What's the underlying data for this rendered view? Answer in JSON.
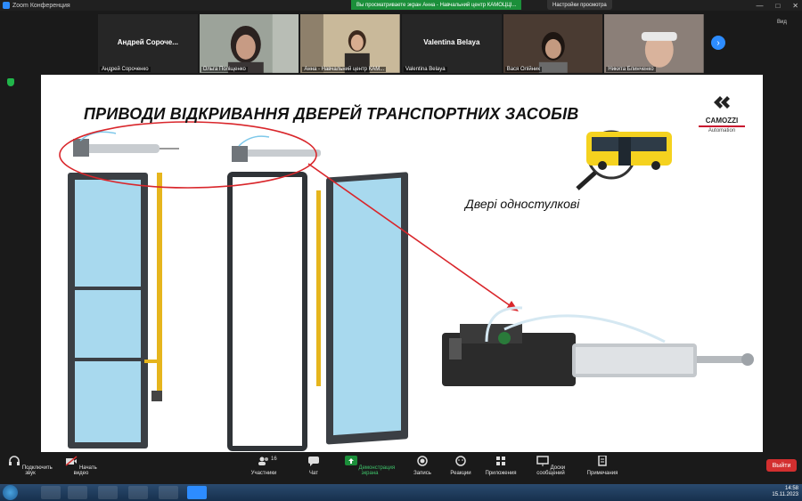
{
  "window": {
    "title": "Zoom Конференция",
    "share_banner": "Вы просматриваете экран Анна - Навчальний центр КАМОЦЦІ...",
    "view_options": "Настройки просмотра",
    "view_label": "Вид"
  },
  "participants": [
    {
      "big_name": "Андрей  Сороче...",
      "tag": "Андрей Сороченко",
      "video": false
    },
    {
      "big_name": "",
      "tag": "Ольга Поліщенко",
      "video": true,
      "bg": "#9ca39a",
      "face": "#c79b84",
      "hair": "#2b2220"
    },
    {
      "big_name": "",
      "tag": "Анна - Навчальний центр КАМ...",
      "video": true,
      "bg": "#c9b99a",
      "face": "#d8ad8f",
      "hair": "#3d2a1e"
    },
    {
      "big_name": "Valentina Belaya",
      "tag": "Valentina Belaya",
      "video": false
    },
    {
      "big_name": "",
      "tag": "Вася Олійник",
      "video": true,
      "bg": "#4a3b32",
      "face": "#c49a80",
      "hair": "#1e1612"
    },
    {
      "big_name": "",
      "tag": "Никита Блинченко",
      "video": true,
      "bg": "#8b7f78",
      "face": "#d9b39c",
      "hair": "#e8e8e8"
    }
  ],
  "slide": {
    "title": "ПРИВОДИ ВІДКРИВАННЯ ДВЕРЕЙ ТРАНСПОРТНИХ ЗАСОБІВ",
    "caption": "Двері одностулкові",
    "logo_brand": "CAMOZZI",
    "logo_sub": "Automation"
  },
  "toolbar": {
    "audio": "Подключить звук",
    "video": "Начать видео",
    "participants": "Участники",
    "participants_count": "16",
    "chat": "Чат",
    "share": "Демонстрация экрана",
    "record": "Запись",
    "reactions": "Реакции",
    "apps": "Приложения",
    "whiteboard": "Доски сообщений",
    "notes": "Примечания",
    "leave": "Выйти"
  },
  "taskbar": {
    "time": "14:58",
    "date": "15.11.2023"
  },
  "colors": {
    "accent": "#2d8cff",
    "leave": "#d32f2f",
    "share_green": "#1b8f3a",
    "brand_red": "#c8102e",
    "bus_yellow": "#f5d21f",
    "rod_yellow": "#e6b51d",
    "annotation_red": "#d9262b"
  }
}
